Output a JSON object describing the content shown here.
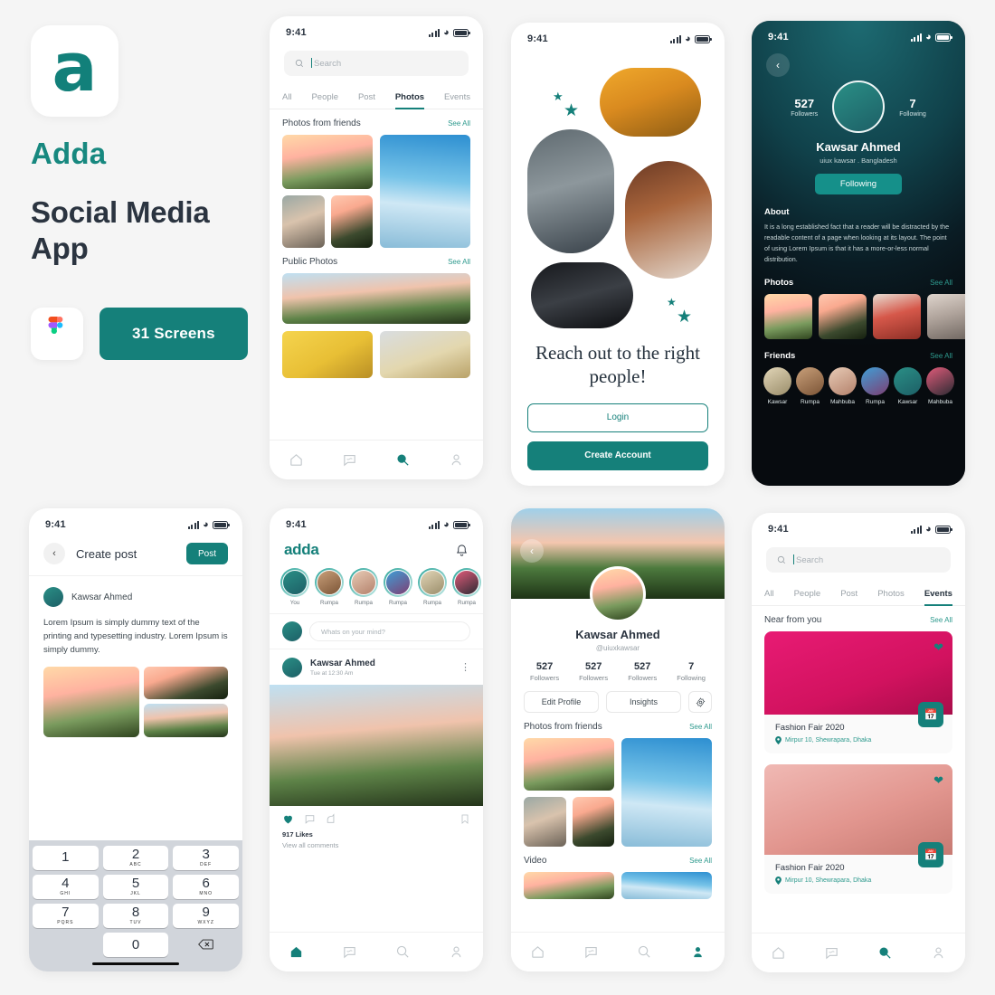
{
  "brand": {
    "logo_glyph": "a",
    "name": "Adda",
    "tagline": "Social Media App",
    "screens_label": "31 Screens",
    "accent": "#15807A",
    "figma_icon": "figma-icon"
  },
  "status_bar": {
    "time": "9:41"
  },
  "search_screen": {
    "search": {
      "placeholder": "Search",
      "icon": "search-icon"
    },
    "tabs": [
      {
        "label": "All",
        "active": false
      },
      {
        "label": "People",
        "active": false
      },
      {
        "label": "Post",
        "active": false
      },
      {
        "label": "Photos",
        "active": true
      },
      {
        "label": "Events",
        "active": false
      }
    ],
    "sections": [
      {
        "title": "Photos from friends",
        "see_all": "See All"
      },
      {
        "title": "Public Photos",
        "see_all": "See All"
      }
    ],
    "nav": [
      {
        "name": "home-icon",
        "active": false
      },
      {
        "name": "chat-icon",
        "active": false
      },
      {
        "name": "search-icon",
        "active": true
      },
      {
        "name": "profile-icon",
        "active": false
      }
    ]
  },
  "onboarding": {
    "headline": "Reach out to the right people!",
    "login_label": "Login",
    "create_account_label": "Create Account"
  },
  "dark_profile": {
    "followers_count": "527",
    "followers_label": "Followers",
    "following_count": "7",
    "following_label": "Following",
    "name": "Kawsar Ahmed",
    "subtitle": "uiux kawsar  .  Bangladesh",
    "follow_button": "Following",
    "about_title": "About",
    "about_text": "It is a long established fact that a reader will be distracted by the readable content of a page when looking at its layout. The point of using Lorem Ipsum is that it has a more-or-less normal distribution.",
    "photos_title": "Photos",
    "photos_see_all": "See All",
    "friends_title": "Friends",
    "friends_see_all": "See All",
    "friends": [
      {
        "name": "Kawsar"
      },
      {
        "name": "Rumpa"
      },
      {
        "name": "Mahbuba"
      },
      {
        "name": "Rumpa"
      },
      {
        "name": "Kawsar"
      },
      {
        "name": "Mahbuba"
      }
    ]
  },
  "create_post": {
    "title": "Create post",
    "post_button": "Post",
    "user_name": "Kawsar Ahmed",
    "body_text": "Lorem Ipsum is simply dummy text of the printing and typesetting industry. Lorem Ipsum is simply dummy.",
    "keypad": [
      {
        "digit": "1",
        "letters": ""
      },
      {
        "digit": "2",
        "letters": "ABC"
      },
      {
        "digit": "3",
        "letters": "DEF"
      },
      {
        "digit": "4",
        "letters": "GHI"
      },
      {
        "digit": "5",
        "letters": "JKL"
      },
      {
        "digit": "6",
        "letters": "MNO"
      },
      {
        "digit": "7",
        "letters": "PQRS"
      },
      {
        "digit": "8",
        "letters": "TUV"
      },
      {
        "digit": "9",
        "letters": "WXYZ"
      },
      {
        "digit": "0",
        "letters": ""
      }
    ],
    "backspace_icon": "backspace-icon"
  },
  "feed": {
    "logo": "adda",
    "bell_icon": "bell-icon",
    "stories": [
      {
        "label": "You"
      },
      {
        "label": "Rumpa"
      },
      {
        "label": "Rumpa"
      },
      {
        "label": "Rumpa"
      },
      {
        "label": "Rumpa"
      },
      {
        "label": "Rumpa"
      }
    ],
    "composer_placeholder": "Whats on your mind?",
    "post": {
      "author": "Kawsar Ahmed",
      "time": "Tue at 12:30 Am",
      "likes": "917 Likes",
      "comments_link": "View all comments",
      "menu_icon": "more-vertical-icon",
      "like_icon": "heart-icon",
      "comment_icon": "comment-icon",
      "share_icon": "share-icon",
      "save_icon": "bookmark-icon"
    },
    "nav": [
      {
        "name": "home-icon",
        "active": true
      },
      {
        "name": "chat-icon",
        "active": false
      },
      {
        "name": "search-icon",
        "active": false
      },
      {
        "name": "profile-icon",
        "active": false
      }
    ]
  },
  "profile": {
    "name": "Kawsar Ahmed",
    "handle": "@uiuxkawsar",
    "stats": [
      {
        "value": "527",
        "label": "Followers"
      },
      {
        "value": "527",
        "label": "Followers"
      },
      {
        "value": "527",
        "label": "Followers"
      },
      {
        "value": "7",
        "label": "Following"
      }
    ],
    "edit_profile": "Edit Profile",
    "insights": "Insights",
    "settings_icon": "gear-icon",
    "sections": [
      {
        "title": "Photos from friends",
        "see_all": "See All"
      },
      {
        "title": "Video",
        "see_all": "See All"
      }
    ],
    "nav": [
      {
        "name": "home-icon",
        "active": false
      },
      {
        "name": "chat-icon",
        "active": false
      },
      {
        "name": "search-icon",
        "active": false
      },
      {
        "name": "profile-icon",
        "active": true
      }
    ]
  },
  "events": {
    "search": {
      "placeholder": "Search",
      "icon": "search-icon"
    },
    "tabs": [
      {
        "label": "All",
        "active": false
      },
      {
        "label": "People",
        "active": false
      },
      {
        "label": "Post",
        "active": false
      },
      {
        "label": "Photos",
        "active": false
      },
      {
        "label": "Events",
        "active": true
      }
    ],
    "section": {
      "title": "Near from you",
      "see_all": "See All"
    },
    "cards": [
      {
        "title": "Fashion Fair 2020",
        "location": "Mirpur 10, Shewrapara, Dhaka",
        "heart_icon": "heart-icon",
        "calendar_icon": "calendar-icon"
      },
      {
        "title": "Fashion Fair 2020",
        "location": "Mirpur 10, Shewrapara, Dhaka",
        "heart_icon": "heart-icon",
        "calendar_icon": "calendar-icon"
      }
    ],
    "nav": [
      {
        "name": "home-icon",
        "active": false
      },
      {
        "name": "chat-icon",
        "active": false
      },
      {
        "name": "search-icon",
        "active": true
      },
      {
        "name": "profile-icon",
        "active": false
      }
    ]
  }
}
